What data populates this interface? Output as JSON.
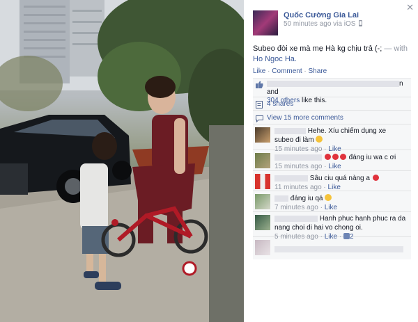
{
  "post": {
    "author": "Quốc Cường Gia Lai",
    "time": "50 minutes ago via iOS",
    "caption": "Subeo đòi xe mà mẹ Hà kg chịu trả (-; ",
    "with_label": "— with ",
    "tagged": "Ho Ngoc Ha.",
    "close": "✕"
  },
  "actions": {
    "like": "Like",
    "comment": "Comment",
    "share": "Share",
    "sep": " · "
  },
  "ufi": {
    "likes_suffix": "n and",
    "likes_others": "304 others",
    "likes_tail": " like this.",
    "shares": "4 shares",
    "more_comments": "View 15 more comments"
  },
  "comments": [
    {
      "text": "Hehe. Xíu chiếm dụng xe subeo đi làm",
      "time": "15 minutes ago",
      "like": "Like",
      "emoji": "smile"
    },
    {
      "text": "đáng iu wa c ơi",
      "time": "15 minutes ago",
      "like": "Like",
      "hearts": 3
    },
    {
      "text": "Sâu ciu quá nàng a",
      "time": "11 minutes ago",
      "like": "Like",
      "hearts": 1
    },
    {
      "text": "đáng iu qá",
      "time": "7 minutes ago",
      "like": "Like",
      "emoji": "smile"
    },
    {
      "text": "Hanh phuc hanh phuc ra da nang choi di hai vo chong oi.",
      "time": "5 minutes ago",
      "like": "Like",
      "likes": "2"
    }
  ],
  "colors": {
    "link": "#3b5998",
    "meta": "#9197a3",
    "ufi_bg": "#f6f7f8"
  }
}
